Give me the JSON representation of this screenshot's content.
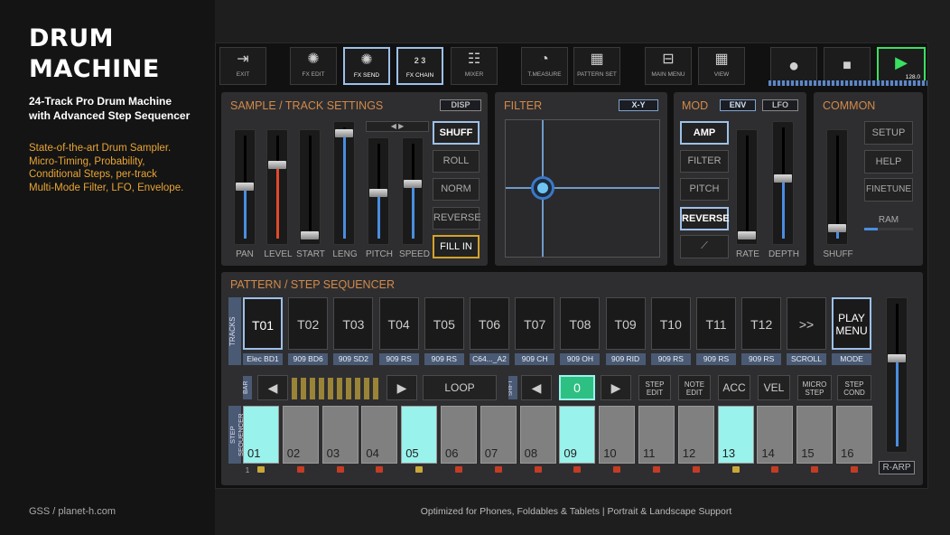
{
  "promo": {
    "title_line1": "DRUM",
    "title_line2": "MACHINE",
    "subtitle_line1": "24-Track Pro Drum Machine",
    "subtitle_line2": "with Advanced Step Sequencer",
    "desc_line1": "State-of-the-art Drum Sampler.",
    "desc_line2": "Micro-Timing, Probability,",
    "desc_line3": "Conditional Steps, per-track",
    "desc_line4": "Multi-Mode Filter, LFO, Envelope.",
    "brand": "GSS / planet-h.com"
  },
  "footer": {
    "text": "Optimized for Phones, Foldables & Tablets | Portrait & Landscape Support"
  },
  "toolbar": {
    "exit": "EXIT",
    "fx_edit": "FX EDIT",
    "fx_send": "FX SEND",
    "fx_chain": "FX CHAIN",
    "fx_chain_num": "2 3",
    "mixer": "MIXER",
    "t_measure": "T.MEASURE",
    "pattern_set": "PATTERN SET",
    "main_menu": "MAIN MENU",
    "view": "VIEW",
    "tempo": "128.0"
  },
  "sample": {
    "title": "SAMPLE / TRACK SETTINGS",
    "disp": "DISP",
    "faders": [
      "PAN",
      "LEVEL",
      "START",
      "LENG",
      "PITCH",
      "SPEED"
    ],
    "shuff": "SHUFF",
    "roll": "ROLL",
    "norm": "NORM",
    "reverse": "REVERSE",
    "fill_in": "FILL IN"
  },
  "filter": {
    "title": "FILTER",
    "mode": "X-Y"
  },
  "mod": {
    "title": "MOD",
    "env": "ENV",
    "lfo": "LFO",
    "amp": "AMP",
    "filter": "FILTER",
    "pitch": "PITCH",
    "reverse": "REVERSE",
    "rate": "RATE",
    "depth": "DEPTH"
  },
  "common": {
    "title": "COMMON",
    "setup": "SETUP",
    "help": "HELP",
    "finetune": "FINETUNE",
    "ram": "RAM",
    "shuff": "SHUFF"
  },
  "seq": {
    "title": "PATTERN / STEP SEQUENCER",
    "tracks_label": "TRACKS",
    "tracks": [
      "T01",
      "T02",
      "T03",
      "T04",
      "T05",
      "T06",
      "T07",
      "T08",
      "T09",
      "T10",
      "T11",
      "T12"
    ],
    "track_names": [
      "Elec BD1",
      "909 BD6",
      "909 SD2",
      "909 RS",
      "909 RS",
      "C64..._A2",
      "909 CH",
      "909 OH",
      "909 RID",
      "909 RS",
      "909 RS",
      "909 RS"
    ],
    "more": ">>",
    "scroll": "SCROLL",
    "play_menu_1": "PLAY",
    "play_menu_2": "MENU",
    "mode": "MODE",
    "bar": "BAR",
    "loop": "LOOP",
    "shift": "SHIFT",
    "shift_value": "0",
    "step_edit_1": "STEP",
    "step_edit_2": "EDIT",
    "note_edit_1": "NOTE",
    "note_edit_2": "EDIT",
    "acc": "ACC",
    "vel": "VEL",
    "micro_step_1": "MICRO",
    "micro_step_2": "STEP",
    "step_cond_1": "STEP",
    "step_cond_2": "COND",
    "step_seq_label": "STEP SEQUENCER",
    "steps": [
      "01",
      "02",
      "03",
      "04",
      "05",
      "06",
      "07",
      "08",
      "09",
      "10",
      "11",
      "12",
      "13",
      "14",
      "15",
      "16"
    ],
    "steps_on": [
      1,
      5,
      9,
      13
    ],
    "bar_num": "1",
    "r_arp": "R-ARP"
  },
  "colors": {
    "accent_blue": "#9ec0e8",
    "orange_title": "#d38a4a",
    "play_green": "#3ae060",
    "step_on": "#9af2ec"
  }
}
